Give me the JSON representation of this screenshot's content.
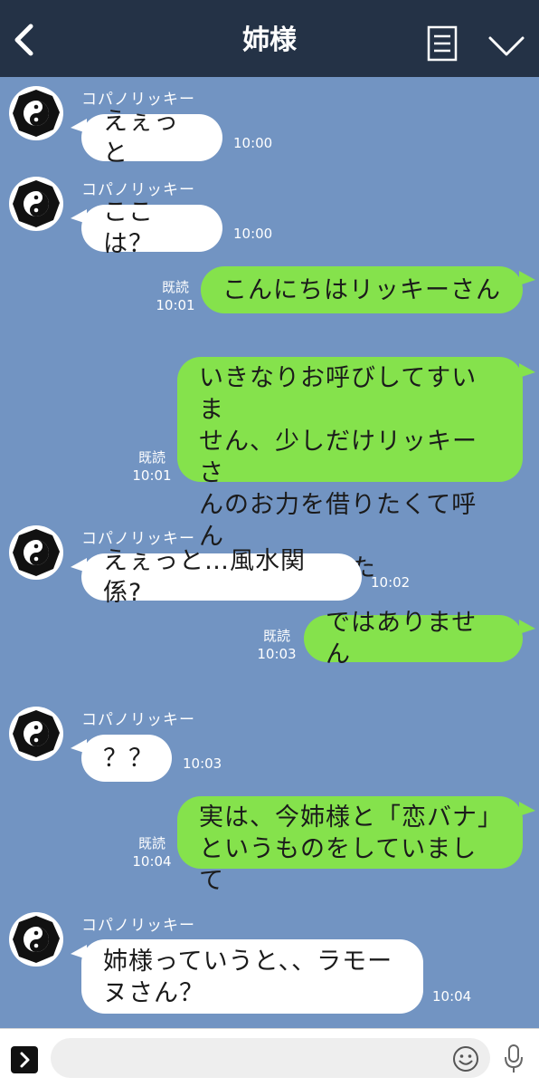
{
  "header": {
    "title": "姉様",
    "back_icon": "chevron-left-icon",
    "notes_icon": "notes-icon",
    "menu_icon": "chevron-down-icon"
  },
  "messages": [
    {
      "side": "in",
      "sender": "コパノリッキー",
      "lines": [
        "えぇっと"
      ],
      "time": "10:00"
    },
    {
      "side": "in",
      "sender": "コパノリッキー",
      "lines": [
        "ここは？"
      ],
      "time": "10:00"
    },
    {
      "side": "out",
      "read": "既読",
      "lines": [
        "こんにちはリッキーさん"
      ],
      "time": "10:01"
    },
    {
      "side": "out",
      "read": "既読",
      "lines": [
        "いきなりお呼びしてすいま",
        "せん、少しだけリッキーさ",
        "んのお力を借りたくて呼ん",
        "でしまいました"
      ],
      "time": "10:01"
    },
    {
      "side": "in",
      "sender": "コパノリッキー",
      "lines": [
        "えぇっと…風水関係?"
      ],
      "time": "10:02"
    },
    {
      "side": "out",
      "read": "既読",
      "lines": [
        "ではありません"
      ],
      "time": "10:03"
    },
    {
      "side": "in",
      "sender": "コパノリッキー",
      "lines": [
        "？？"
      ],
      "time": "10:03"
    },
    {
      "side": "out",
      "read": "既読",
      "lines": [
        "実は、今姉様と「恋バナ」",
        "というものをしていまして"
      ],
      "time": "10:04"
    },
    {
      "side": "in",
      "sender": "コパノリッキー",
      "lines": [
        "姉様っていうと、、ラモー",
        "ヌさん？"
      ],
      "time": "10:04"
    }
  ],
  "input": {
    "placeholder": "",
    "value": "",
    "menu_icon": "chevron-right-icon",
    "emoji_icon": "smiley-icon",
    "mic_icon": "microphone-icon"
  },
  "colors": {
    "background": "#7294c2",
    "header": "#243246",
    "incoming_bubble": "#ffffff",
    "outgoing_bubble": "#85e24c"
  }
}
